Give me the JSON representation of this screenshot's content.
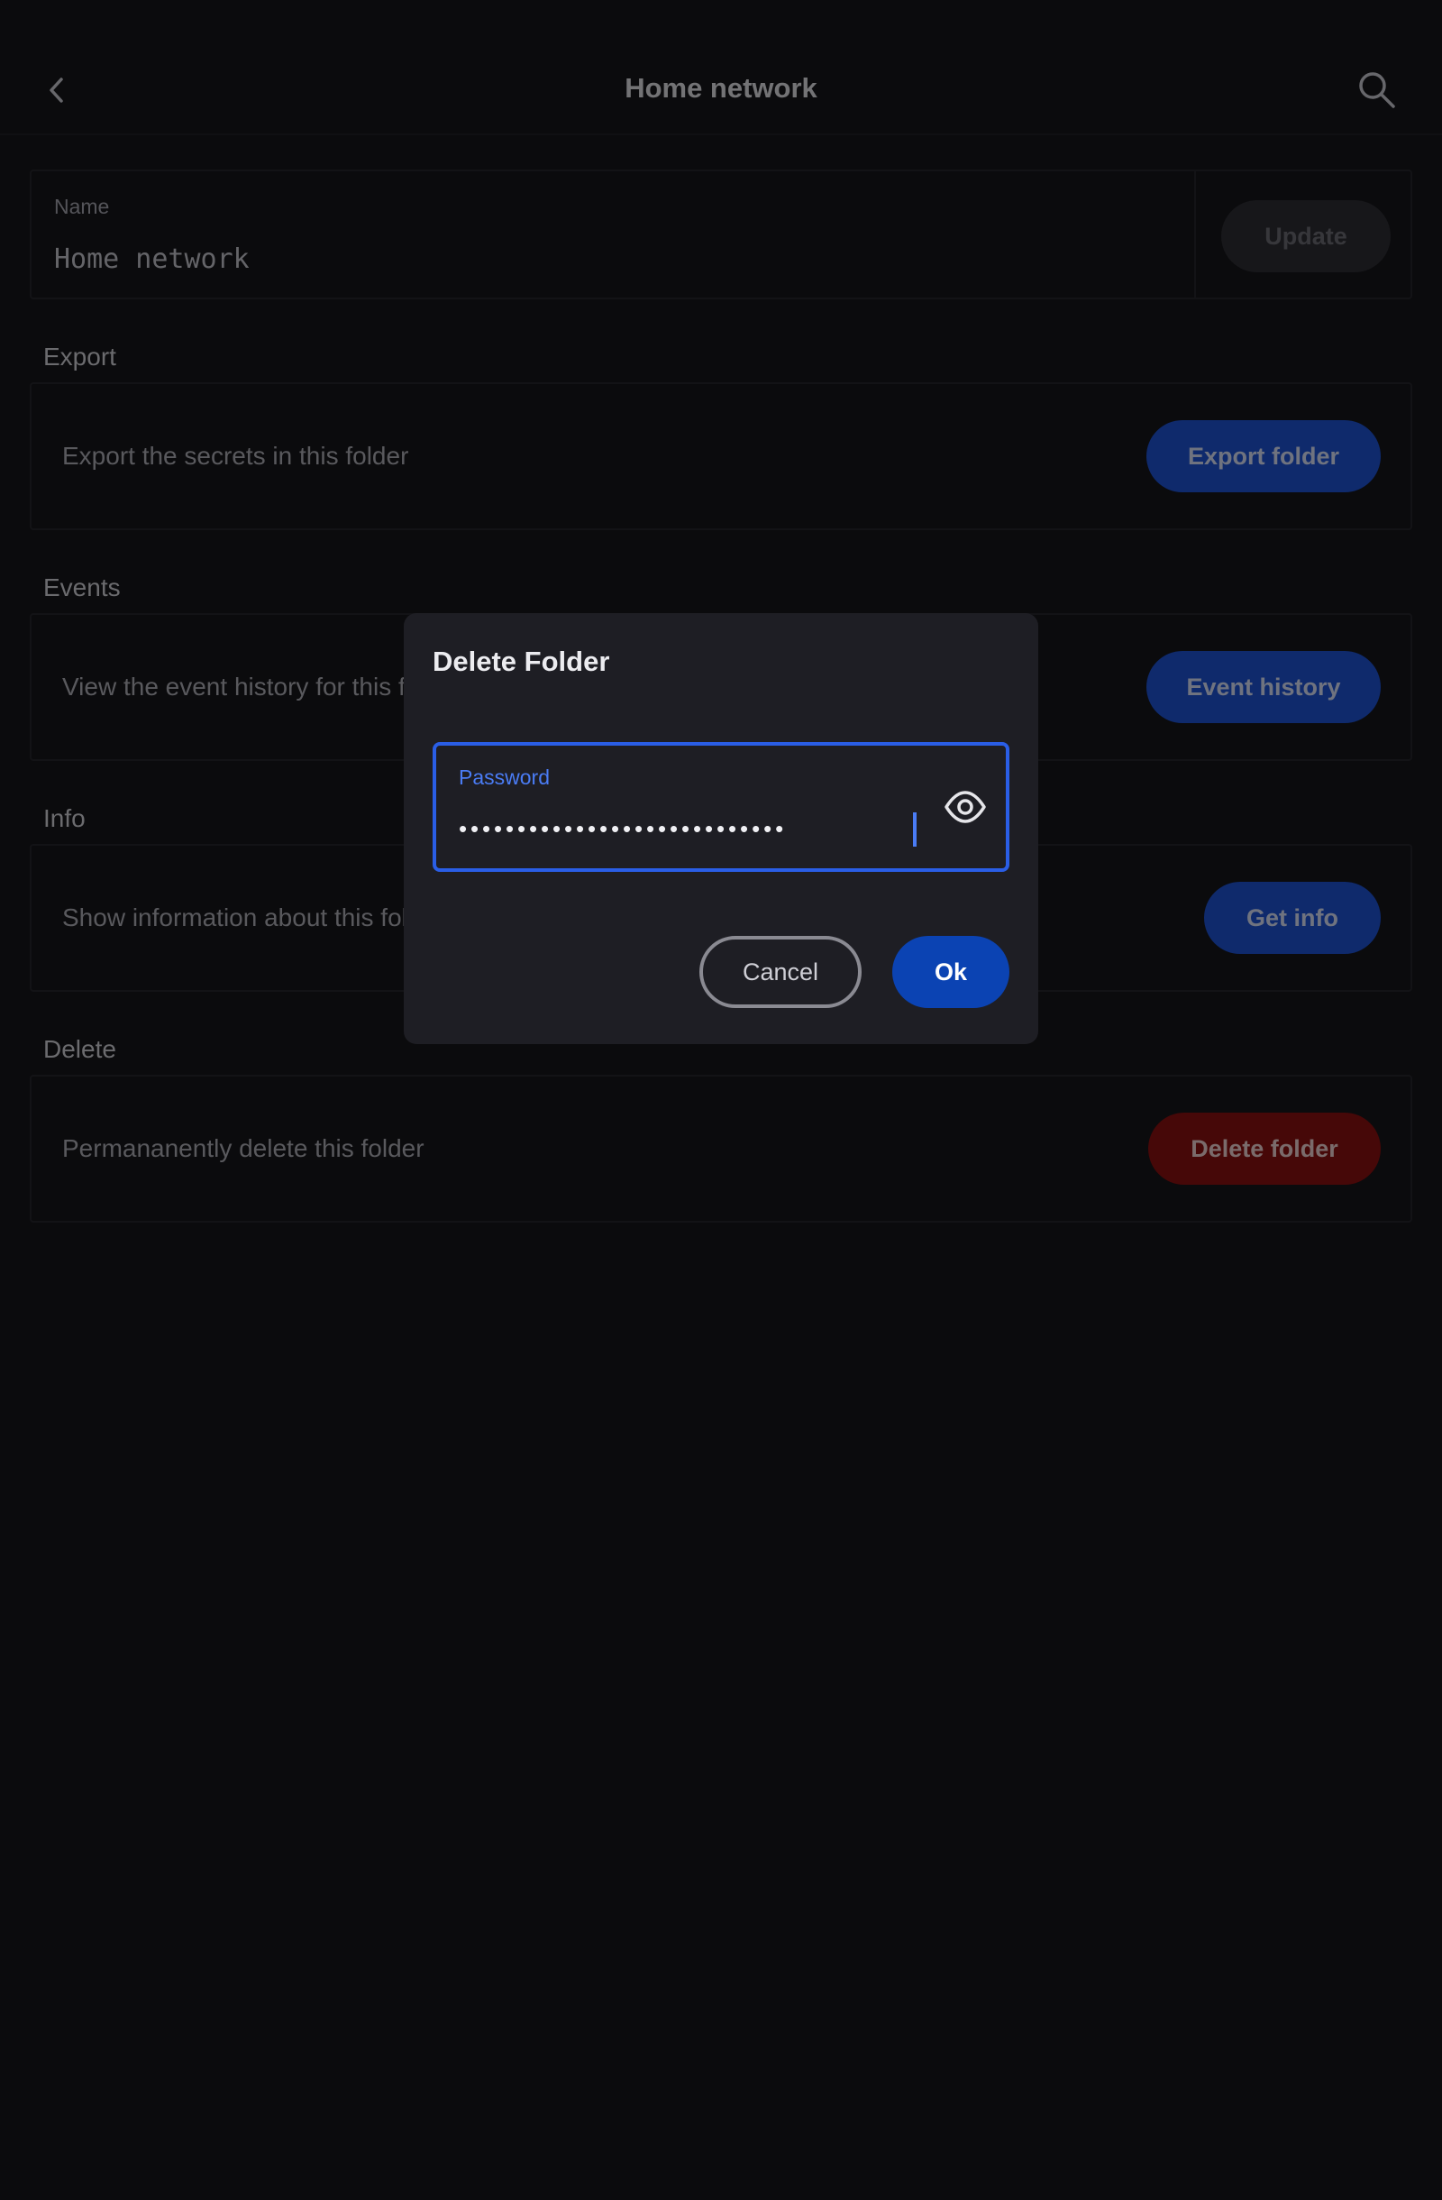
{
  "header": {
    "title": "Home network",
    "back_icon": "chevron-left-icon",
    "search_icon": "search-icon"
  },
  "name_card": {
    "label": "Name",
    "value": "Home network",
    "update_label": "Update"
  },
  "sections": {
    "export": {
      "title": "Export",
      "text": "Export the secrets in this folder",
      "button": "Export folder"
    },
    "events": {
      "title": "Events",
      "text": "View the event history for this folder",
      "button": "Event history"
    },
    "info": {
      "title": "Info",
      "text": "Show information about this folder",
      "button": "Get info"
    },
    "delete": {
      "title": "Delete",
      "text": "Permananently delete this folder",
      "button": "Delete folder"
    }
  },
  "dialog": {
    "title": "Delete Folder",
    "password_label": "Password",
    "password_mask": "••••••••••••••••••••••••••••",
    "visibility_icon": "eye-icon",
    "cancel_label": "Cancel",
    "ok_label": "Ok"
  },
  "colors": {
    "primary": "#1e54d8",
    "primary_dark": "#0b43b3",
    "focus": "#2a5ee6",
    "danger": "#8c1010",
    "background": "#16161a",
    "dialog_surface": "#1e1e24"
  }
}
